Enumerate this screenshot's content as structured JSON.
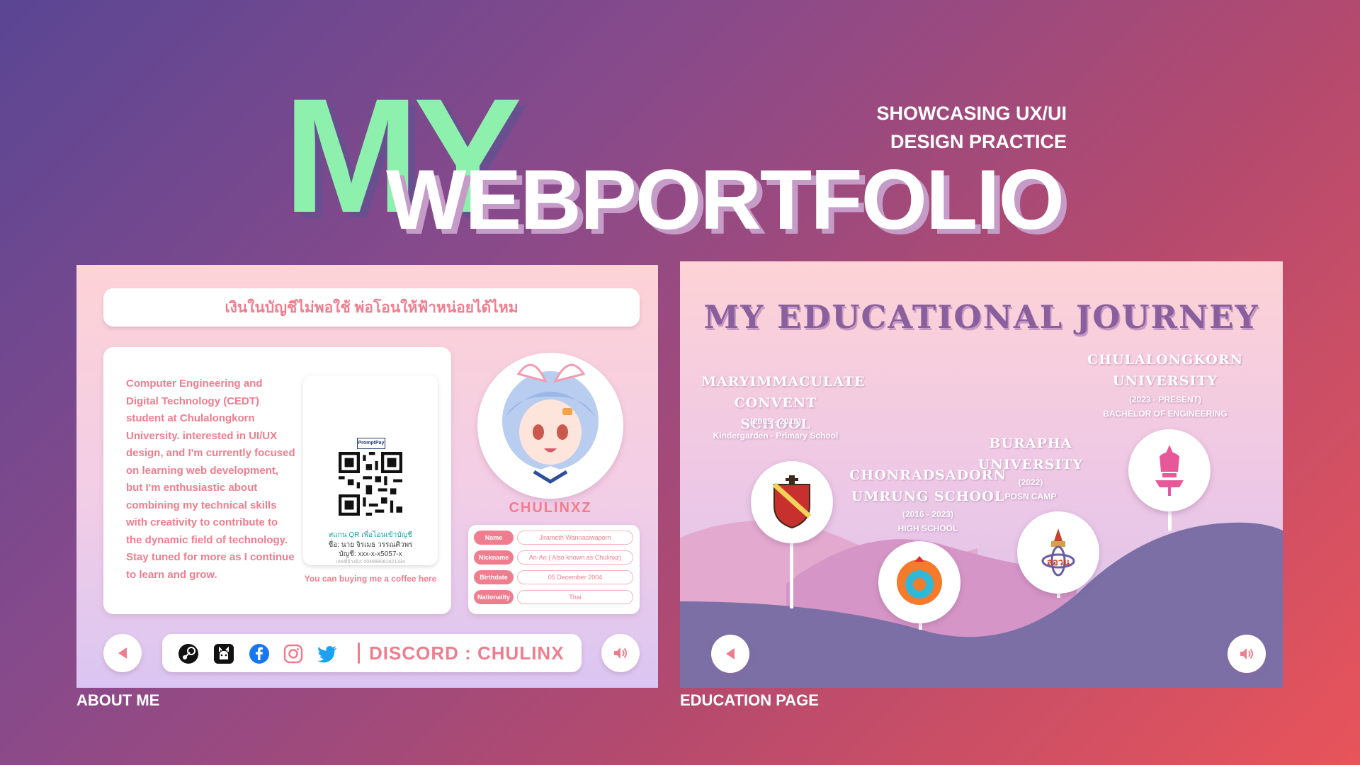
{
  "hero": {
    "my": "MY",
    "webportfolio": "WEBPORTFOLIO",
    "tagline_line1": "SHOWCASING UX/UI",
    "tagline_line2": "DESIGN PRACTICE"
  },
  "captions": {
    "about": "ABOUT ME",
    "education": "EDUCATION PAGE"
  },
  "about": {
    "banner": "เงินในบัญชีไม่พอใช้ พ่อโอนให้ฟ้าหน่อยได้ไหม",
    "bio": "Computer Engineering and Digital Technology (CEDT) student at Chulalongkorn University. interested in UI/UX design, and I'm currently focused on learning web development, but I'm enthusiastic about combining my technical skills with creativity to contribute to the dynamic field of technology. Stay tuned for more as I continue to learn and grow.",
    "qr": {
      "brand": "PromptPay",
      "line1": "สแกน QR เพื่อโอนเข้าบัญชี",
      "line2": "ชื่อ: นาย จิรเมธ วรรณศิวพร",
      "line3": "บัญชี: xxx-x-x5057-x",
      "line4": "เลขที่อ้างอิง: 004999081821334"
    },
    "coffee": "You can buying me a coffee here",
    "nickname_title": "CHULINXZ",
    "info": [
      {
        "label": "Name",
        "value": "Jirameth  Wannasiwaporn"
      },
      {
        "label": "Nickname",
        "value": "An-An ( Also known as Chulinxz)"
      },
      {
        "label": "Birthdate",
        "value": "05 December 2004"
      },
      {
        "label": "Nationality",
        "value": "Thai"
      }
    ],
    "discord": "DISCORD : CHULINX",
    "social_icons": [
      "steam-icon",
      "github-icon",
      "facebook-icon",
      "instagram-icon",
      "twitter-icon"
    ]
  },
  "education": {
    "title": "MY EDUCATIONAL JOURNEY",
    "schools": [
      {
        "name_l1": "MARYIMMACULATE",
        "name_l2": "CONVENT SCHOOL",
        "years": "(2005 - 2016)",
        "level": "Kindergarden - Primary School"
      },
      {
        "name_l1": "CHONRADSADORN",
        "name_l2": "UMRUNG SCHOOL",
        "years": "(2016 - 2023)",
        "level": "HIGH SCHOOL"
      },
      {
        "name_l1": "BURAPHA",
        "name_l2": "UNIVERSITY",
        "years": "(2022)",
        "level": "POSN CAMP"
      },
      {
        "name_l1": "CHULALONGKORN",
        "name_l2": "UNIVERSITY",
        "years": "(2023 - PRESENT)",
        "level": "BACHELOR OF ENGINEERING"
      }
    ]
  },
  "colors": {
    "accent_pink": "#f07d8e",
    "mint": "#8ef0ad",
    "hill_purple": "#7b6fa6"
  }
}
